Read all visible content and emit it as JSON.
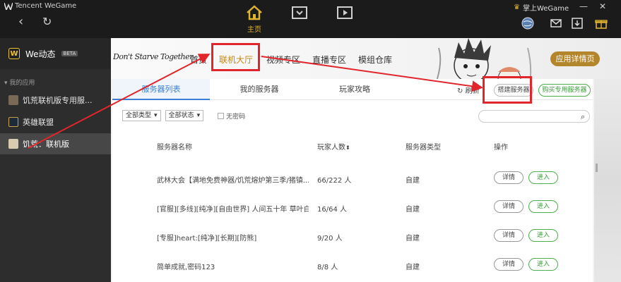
{
  "window": {
    "brand": "Tencent WeGame",
    "mobile_wegame": "掌上WeGame",
    "top_nav": [
      {
        "label": "主页",
        "icon": "home-icon",
        "active": true
      },
      {
        "label": "",
        "icon": "inbox-icon",
        "active": false
      },
      {
        "label": "",
        "icon": "video-icon",
        "active": false
      }
    ],
    "accent": "#e0b431"
  },
  "sidebar": {
    "we_label": "We动态",
    "beta": "BETA",
    "section_title": "我的应用",
    "apps": [
      {
        "label": "饥荒联机版专用服...",
        "active": false
      },
      {
        "label": "英雄联盟",
        "active": false
      },
      {
        "label": "饥荒：联机版",
        "active": true
      }
    ]
  },
  "game": {
    "title": "Don't Starve Together",
    "nav": [
      "首页",
      "联机大厅",
      "视频专区",
      "直播专区",
      "模组仓库"
    ],
    "active_nav": 1,
    "detail_button": "应用详情页"
  },
  "tabs": [
    "服务器列表",
    "我的服务器",
    "玩家攻略"
  ],
  "toolbar": {
    "refresh": "刷新",
    "build": "搭建服务器",
    "buy": "购买专用服务器"
  },
  "filters": {
    "type": "全部类型",
    "status": "全部状态",
    "no_password": "无密码"
  },
  "table": {
    "headers": {
      "name": "服务器名称",
      "players": "玩家人数",
      "type": "服务器类型",
      "ops": "操作"
    },
    "rows": [
      {
        "name": "武林大会【满地免费神器/饥荒熔炉第三季/猪镇...",
        "players": "66/222 人",
        "type": "自建"
      },
      {
        "name": "[官服][多线][纯净][自由世界] 人间五十年 草叶白...",
        "players": "16/64 人",
        "type": "自建"
      },
      {
        "name": "[专服]heart:[纯净][长期][防熊]",
        "players": "9/20 人",
        "type": "自建"
      },
      {
        "name": "简单成就,密码123",
        "players": "8/8 人",
        "type": "自建"
      },
      {
        "name": "",
        "players": "",
        "type": ""
      }
    ],
    "detail_label": "详情",
    "enter_label": "进入"
  },
  "annotation_color": "#e0262b"
}
